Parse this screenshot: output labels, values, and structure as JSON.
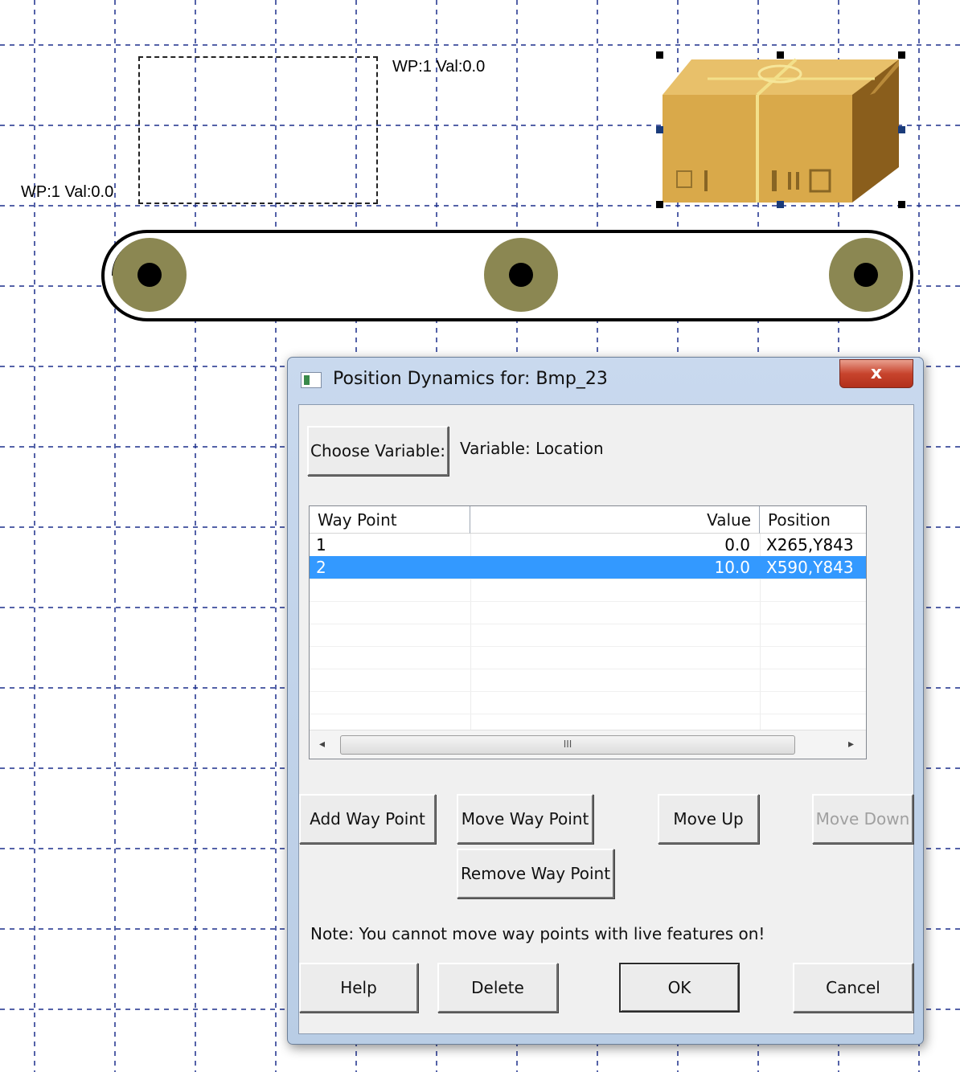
{
  "canvas": {
    "wp_label_left": "WP:1 Val:0.0",
    "wp_label_top": "WP:1 Val:0.0"
  },
  "dialog": {
    "title": "Position Dynamics for: Bmp_23",
    "close_label": "x",
    "choose_variable_label": "Choose Variable:",
    "variable_text": "Variable: Location",
    "table": {
      "columns": [
        "Way Point",
        "Value",
        "Position"
      ],
      "rows": [
        {
          "way_point": "1",
          "value": "0.0",
          "position": "X265,Y843",
          "selected": false
        },
        {
          "way_point": "2",
          "value": "10.0",
          "position": "X590,Y843",
          "selected": true
        }
      ],
      "scroll_thumb_grip": "III"
    },
    "buttons": {
      "add_way_point": "Add Way Point",
      "move_way_point": "Move Way Point",
      "move_up": "Move Up",
      "move_down": "Move Down",
      "remove_way_point": "Remove Way Point",
      "help": "Help",
      "delete": "Delete",
      "ok": "OK",
      "cancel": "Cancel"
    },
    "note": "Note: You cannot move way points with live features on!"
  },
  "colors": {
    "grid_line": "#1c2f8c",
    "selection": "#3399ff",
    "roller": "#8b8752",
    "box": "#d9a94a"
  }
}
